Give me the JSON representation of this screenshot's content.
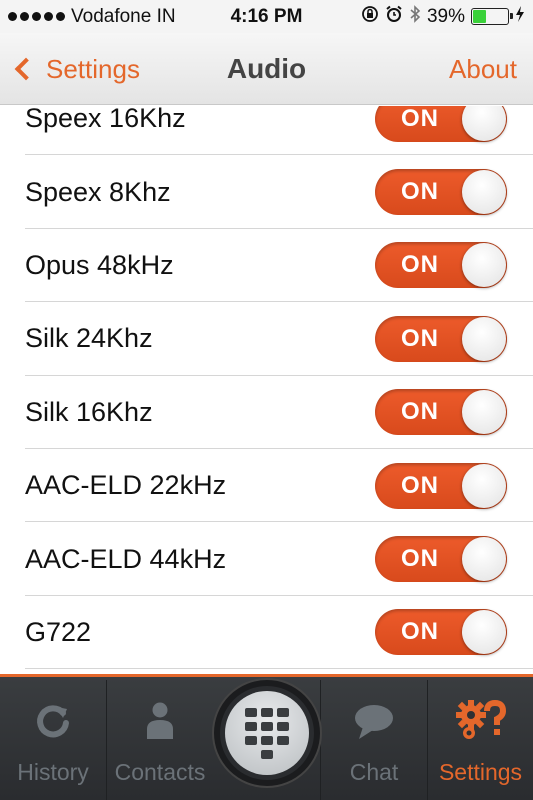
{
  "status_bar": {
    "carrier": "Vodafone IN",
    "time": "4:16 PM",
    "battery_percent": "39%",
    "battery_level": 0.39,
    "icons": [
      "signal-dots-icon",
      "orientation-lock-icon",
      "alarm-icon",
      "bluetooth-icon",
      "battery-icon",
      "charging-icon"
    ]
  },
  "nav": {
    "back_label": "Settings",
    "title": "Audio",
    "right_label": "About"
  },
  "codecs": [
    {
      "label": "Speex 16Khz",
      "state": "ON"
    },
    {
      "label": "Speex 8Khz",
      "state": "ON"
    },
    {
      "label": "Opus 48kHz",
      "state": "ON"
    },
    {
      "label": "Silk 24Khz",
      "state": "ON"
    },
    {
      "label": "Silk 16Khz",
      "state": "ON"
    },
    {
      "label": "AAC-ELD 22kHz",
      "state": "ON"
    },
    {
      "label": "AAC-ELD 44kHz",
      "state": "ON"
    },
    {
      "label": "G722",
      "state": "ON"
    }
  ],
  "tab_bar": {
    "tabs": [
      {
        "label": "History",
        "icon": "refresh-icon",
        "active": false
      },
      {
        "label": "Contacts",
        "icon": "person-icon",
        "active": false
      },
      {
        "label": "",
        "icon": "keypad-icon",
        "active": false
      },
      {
        "label": "Chat",
        "icon": "speech-bubble-icon",
        "active": false
      },
      {
        "label": "Settings",
        "icon": "gears-question-icon",
        "active": true
      }
    ]
  },
  "colors": {
    "accent": "#e4672b",
    "toggle_on": "#e0522a",
    "tab_inactive": "#6b7278",
    "tab_bg": "#2e3033"
  }
}
